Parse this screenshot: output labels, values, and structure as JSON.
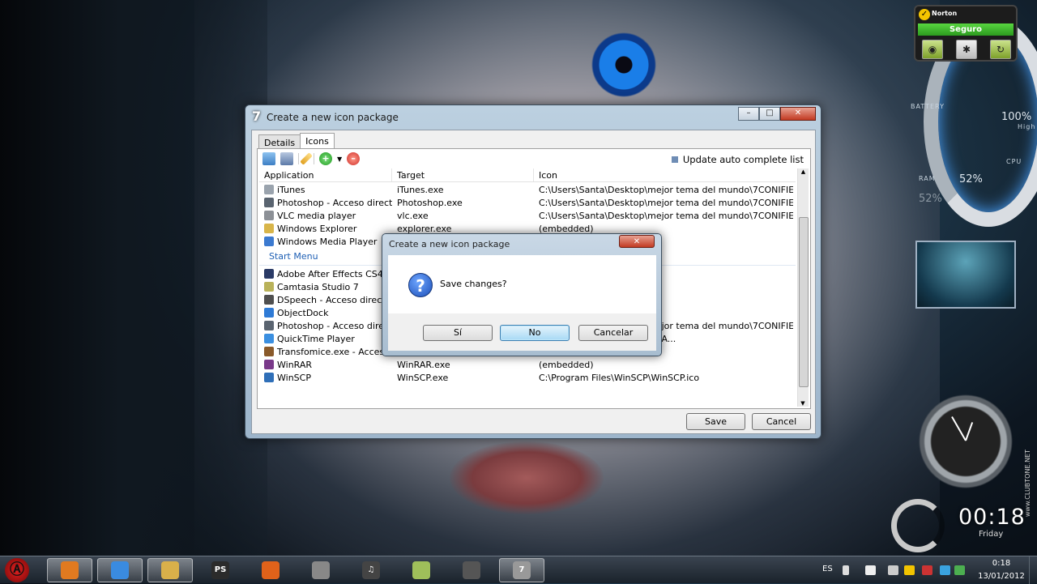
{
  "main_window": {
    "title": "Create a new icon package",
    "logo": "7",
    "tabs": [
      "Details",
      "Icons"
    ],
    "update_label": "Update auto complete list",
    "columns": [
      "Application",
      "Target",
      "Icon"
    ],
    "rows_top": [
      {
        "app": "iTunes",
        "target": "iTunes.exe",
        "icon": "C:\\Users\\Santa\\Desktop\\mejor tema del mundo\\7CONIFIE...",
        "color": "#9aa3ad"
      },
      {
        "app": "Photoshop - Acceso directo",
        "target": "Photoshop.exe",
        "icon": "C:\\Users\\Santa\\Desktop\\mejor tema del mundo\\7CONIFIE...",
        "color": "#5a6470"
      },
      {
        "app": "VLC media player",
        "target": "vlc.exe",
        "icon": "C:\\Users\\Santa\\Desktop\\mejor tema del mundo\\7CONIFIE...",
        "color": "#8c9096"
      },
      {
        "app": "Windows Explorer",
        "target": "explorer.exe",
        "icon": "(embedded)",
        "color": "#d8b54a"
      },
      {
        "app": "Windows Media Player",
        "target": "",
        "icon": "(embedded)",
        "color": "#3c7ad0"
      }
    ],
    "group_label": "Start Menu",
    "rows_start": [
      {
        "app": "Adobe After Effects CS4",
        "target": "",
        "icon": "",
        "color": "#2a3a66"
      },
      {
        "app": "Camtasia Studio 7",
        "target": "",
        "icon": "",
        "color": "#b9b25a"
      },
      {
        "app": "DSpeech - Acceso directo",
        "target": "",
        "icon": "",
        "color": "#4f4f4f"
      },
      {
        "app": "ObjectDock",
        "target": "",
        "icon": "",
        "color": "#2f7bd6"
      },
      {
        "app": "Photoshop - Acceso directo",
        "target": "",
        "icon": "C:\\Users\\Santa\\Desktop\\mejor tema del mundo\\7CONIFIE...",
        "color": "#5a6470"
      },
      {
        "app": "QuickTime Player",
        "target": "",
        "icon": "79-A1C9-4C02-856B-FBB27A...",
        "color": "#3b8fe0"
      },
      {
        "app": "Transfomice.exe - Acceso",
        "target": "Transfomice.exe",
        "icon": "(embedded)",
        "color": "#8a5a2a"
      },
      {
        "app": "WinRAR",
        "target": "WinRAR.exe",
        "icon": "(embedded)",
        "color": "#7a3a8a"
      },
      {
        "app": "WinSCP",
        "target": "WinSCP.exe",
        "icon": "C:\\Program Files\\WinSCP\\WinSCP.ico",
        "color": "#2f6fb8"
      }
    ],
    "save_label": "Save",
    "cancel_label": "Cancel"
  },
  "dialog": {
    "title": "Create a new icon package",
    "message": "Save changes?",
    "yes_label": "Sí",
    "no_label": "No",
    "cancel_label": "Cancelar"
  },
  "norton": {
    "brand": "Norton",
    "status": "Seguro"
  },
  "hud": {
    "battery_label": "BATTERY",
    "battery_value": "100%",
    "battery_sub": "High",
    "cpu_label": "CPU",
    "ram_label": "RAM",
    "ram_value": "52%",
    "ram_value2": "52%"
  },
  "clock": {
    "time": "00:18",
    "day": "Friday",
    "side_text": "www.CLUBTONE.NET"
  },
  "taskbar": {
    "apps": [
      {
        "name": "media-center",
        "color": "#e07a20",
        "label": ""
      },
      {
        "name": "chrome",
        "color": "#3a8be0",
        "label": ""
      },
      {
        "name": "explorer",
        "color": "#d9b04a",
        "label": ""
      },
      {
        "name": "photoshop",
        "color": "#2b2b2b",
        "label": "PS"
      },
      {
        "name": "firefox",
        "color": "#e0621a",
        "label": ""
      },
      {
        "name": "vlc-app",
        "color": "#888",
        "label": ""
      },
      {
        "name": "itunes",
        "color": "#444",
        "label": "♫"
      },
      {
        "name": "notes",
        "color": "#9fbf5a",
        "label": ""
      },
      {
        "name": "camtasia",
        "color": "#555",
        "label": ""
      },
      {
        "name": "seven-conifier",
        "color": "#999",
        "label": "7"
      }
    ],
    "tray": {
      "lang": "ES",
      "time": "0:18",
      "date": "13/01/2012"
    }
  }
}
